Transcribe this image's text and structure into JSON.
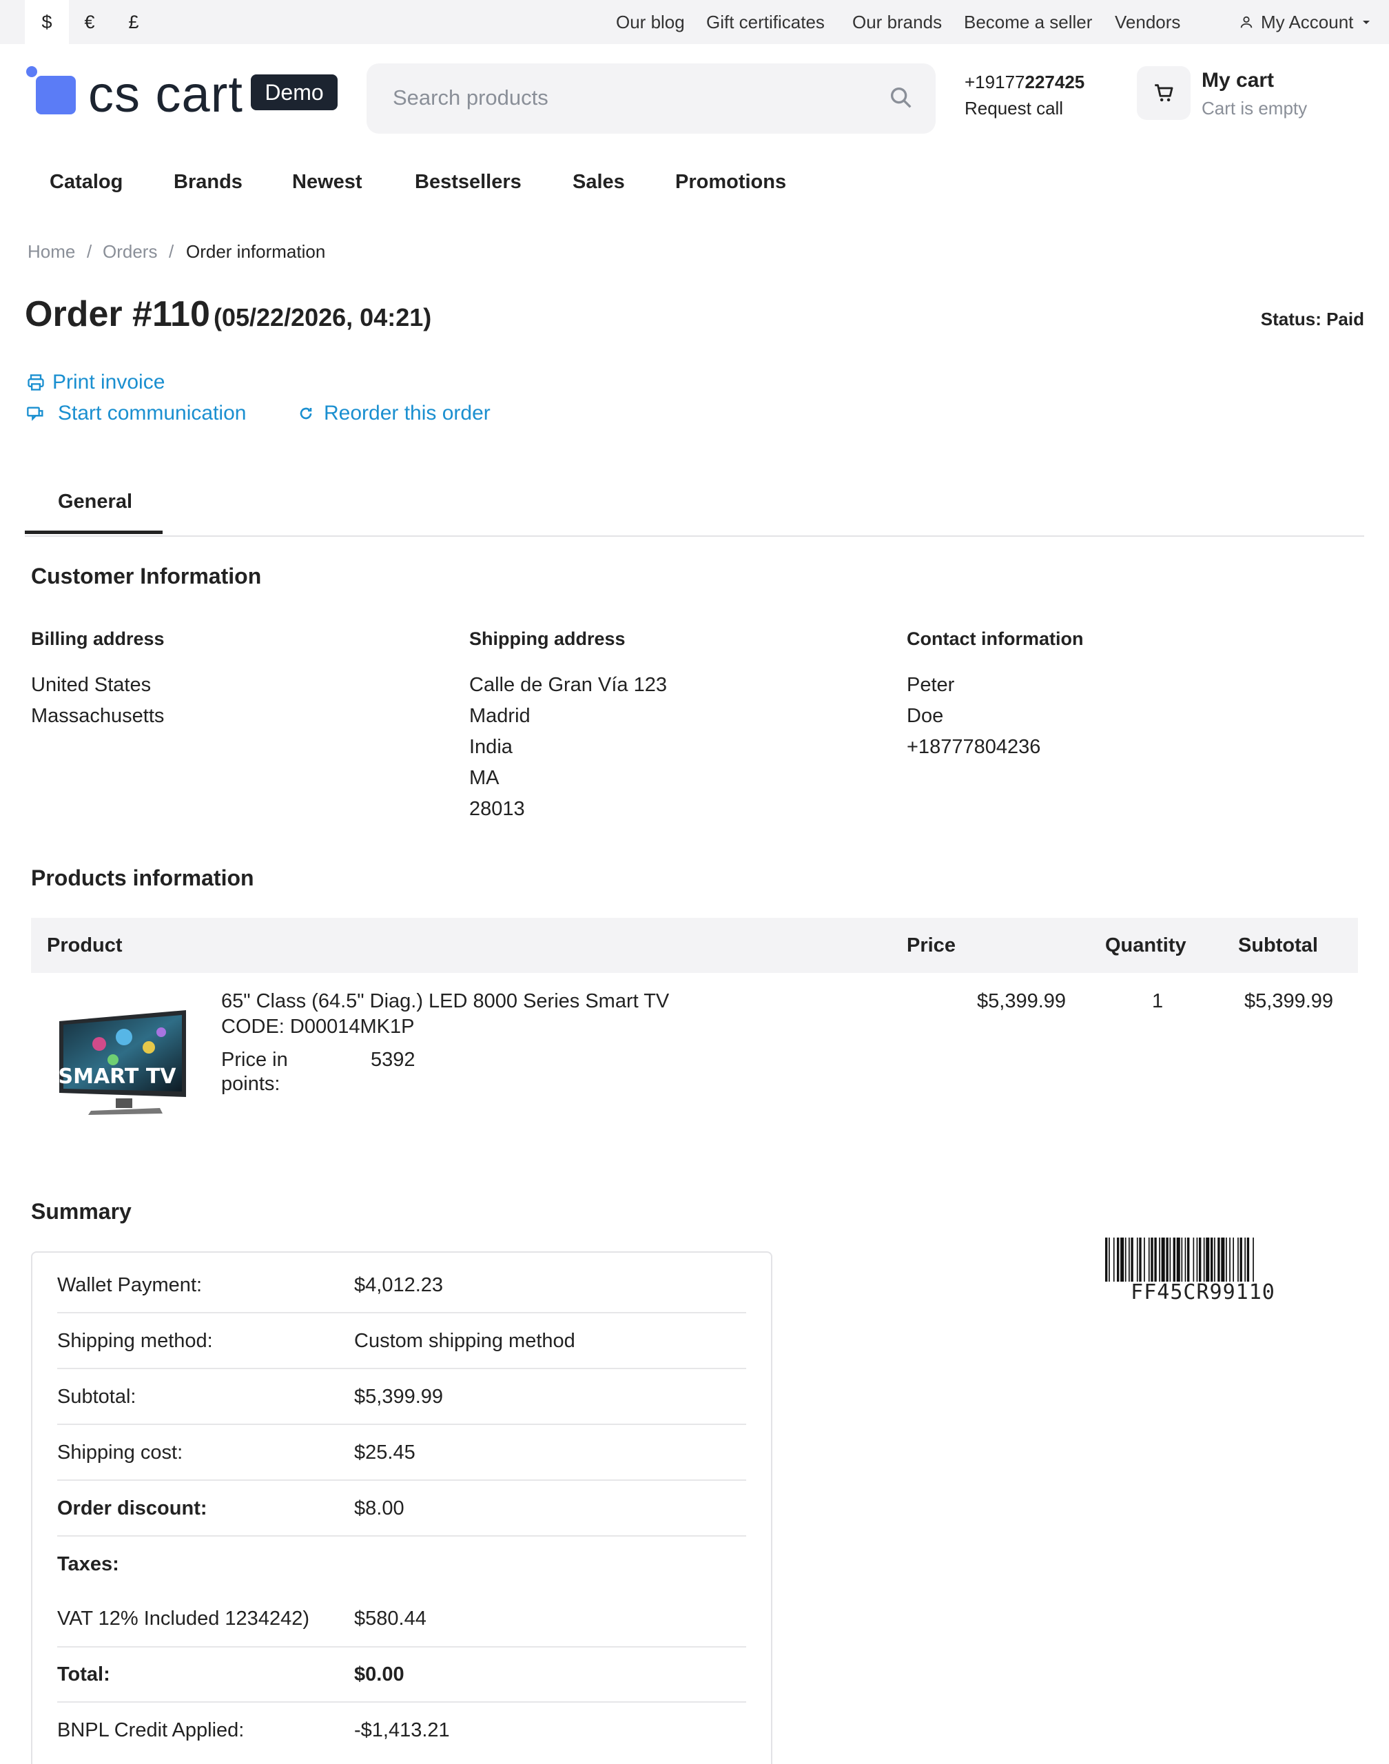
{
  "topbar": {
    "currencies": [
      "$",
      "€",
      "£"
    ],
    "links": [
      "Our blog",
      "Gift certificates",
      "Our brands",
      "Become a seller",
      "Vendors"
    ],
    "account": "My Account"
  },
  "header": {
    "logo_text": "cs cart",
    "demo_badge": "Demo",
    "search_placeholder": "Search products",
    "phone_prefix": "+19177",
    "phone_bold": "227425",
    "request_call": "Request call",
    "cart_title": "My cart",
    "cart_status": "Cart is empty"
  },
  "nav": [
    "Catalog",
    "Brands",
    "Newest",
    "Bestsellers",
    "Sales",
    "Promotions"
  ],
  "breadcrumb": [
    "Home",
    "Orders",
    "Order information"
  ],
  "breadcrumb_sep": "/",
  "order": {
    "title": "Order #110",
    "date": "(05/22/2026, 04:21)",
    "status": "Status: Paid",
    "actions": {
      "print": "Print invoice",
      "communicate": "Start communication",
      "reorder": "Reorder this order"
    },
    "tab": "General"
  },
  "customer": {
    "section_title": "Customer Information",
    "billing": {
      "heading": "Billing address",
      "lines": [
        "United States",
        "Massachusetts"
      ]
    },
    "shipping": {
      "heading": "Shipping address",
      "lines": [
        "Calle de Gran Vía 123",
        "Madrid",
        "India",
        "MA",
        "28013"
      ]
    },
    "contact": {
      "heading": "Contact information",
      "lines": [
        "Peter",
        "Doe",
        "+18777804236"
      ]
    }
  },
  "products": {
    "section_title": "Products information",
    "columns": [
      "Product",
      "Price",
      "Quantity",
      "Subtotal"
    ],
    "rows": [
      {
        "name": "65\" Class (64.5\" Diag.) LED 8000 Series Smart TV",
        "code": "CODE: D00014MK1P",
        "points_label_1": "Price in",
        "points_label_2": "points:",
        "points": "5392",
        "price": "$5,399.99",
        "quantity": "1",
        "subtotal": "$5,399.99",
        "image_text": "SMART TV"
      }
    ]
  },
  "summary": {
    "section_title": "Summary",
    "rows": [
      {
        "label": "Wallet Payment:",
        "value": "$4,012.23"
      },
      {
        "label": "Shipping method:",
        "value": "Custom shipping method"
      },
      {
        "label": "Subtotal:",
        "value": "$5,399.99"
      },
      {
        "label": "Shipping cost:",
        "value": "$25.45"
      },
      {
        "label": "Order discount:",
        "value": "$8.00"
      },
      {
        "label": "Taxes:",
        "value": ""
      },
      {
        "label": "VAT 12% Included 1234242)",
        "value": "$580.44"
      },
      {
        "label": "Total:",
        "value": "$0.00"
      },
      {
        "label": "BNPL Credit Applied:",
        "value": "-$1,413.21"
      }
    ]
  },
  "barcode": {
    "text": "FF45CR99110"
  },
  "colors": {
    "accent": "#1a8fd0",
    "logo": "#5b7cf6",
    "dark": "#1c2430",
    "muted": "#8a8f98",
    "panel": "#f3f3f5"
  }
}
